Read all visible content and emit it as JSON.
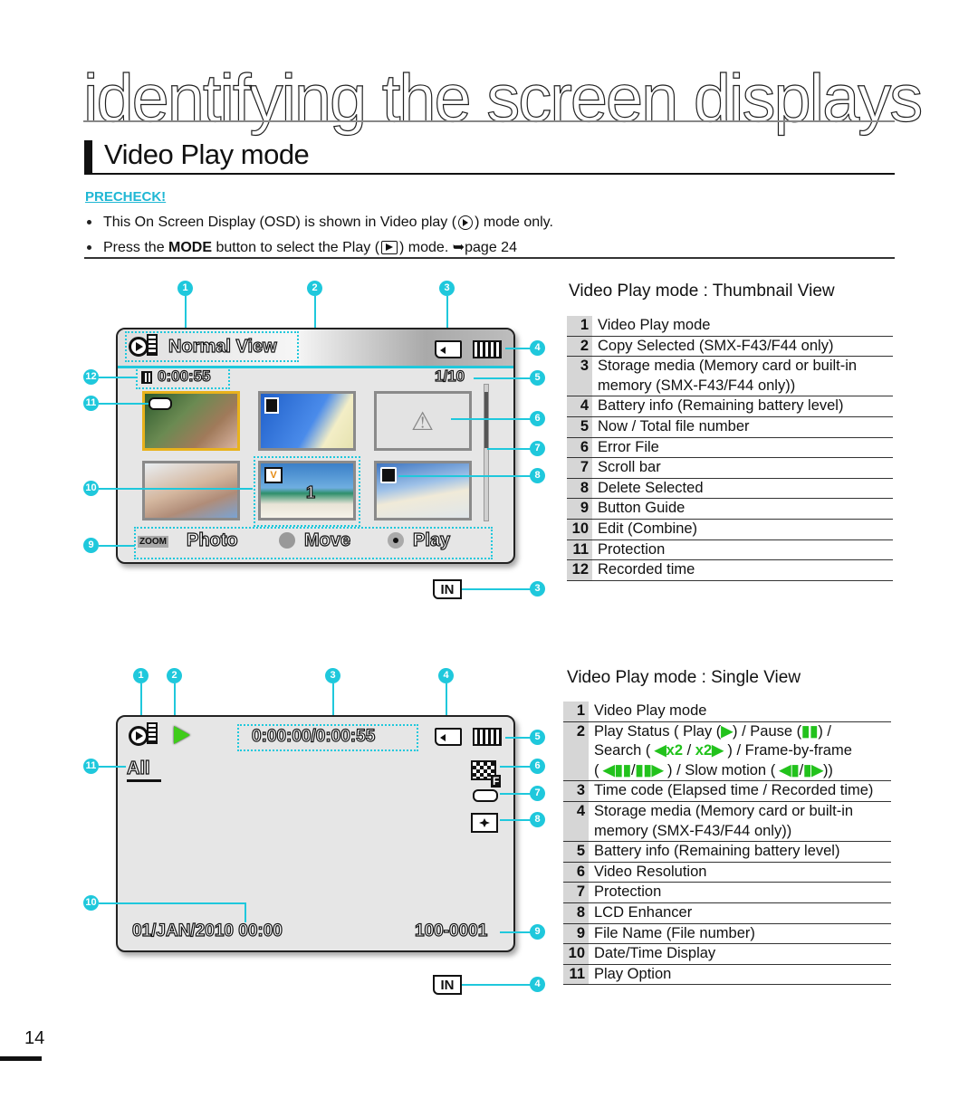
{
  "header": {
    "chapter_title": "identifying the screen displays",
    "section_title": "Video Play mode"
  },
  "precheck": {
    "label": "PRECHECK!",
    "bullets": [
      {
        "before": "This On Screen Display (OSD) is shown in Video play (",
        "icon": "video-play-mode-icon",
        "after": ") mode only."
      },
      {
        "before": "Press the ",
        "bold": "MODE",
        "middle": " button to select the Play (",
        "icon": "play-mode-icon",
        "after": ") mode. ",
        "ref_arrow": "➥",
        "ref": "page 24"
      }
    ]
  },
  "thumbnail_view": {
    "osd": {
      "mode_label": "Normal View",
      "recorded_time": "0:00:55",
      "file_counter": "1/10",
      "combine_number": "1",
      "button_guide": {
        "zoom_key": "ZOOM",
        "zoom_action": "Photo",
        "move_action": "Move",
        "play_action": "Play"
      },
      "storage_label": "IN"
    },
    "callouts": [
      "1",
      "2",
      "3",
      "4",
      "5",
      "6",
      "7",
      "8",
      "9",
      "10",
      "11",
      "12",
      "3"
    ],
    "legend_title": "Video Play mode : Thumbnail View",
    "legend": [
      {
        "num": "1",
        "text": "Video Play mode"
      },
      {
        "num": "2",
        "text": "Copy Selected (SMX-F43/F44 only)"
      },
      {
        "num": "3",
        "text": "Storage media (Memory card or built-in memory (SMX-F43/F44 only))"
      },
      {
        "num": "4",
        "text": "Battery info (Remaining battery level)"
      },
      {
        "num": "5",
        "text": "Now / Total file number"
      },
      {
        "num": "6",
        "text": "Error File"
      },
      {
        "num": "7",
        "text": "Scroll bar"
      },
      {
        "num": "8",
        "text": "Delete Selected"
      },
      {
        "num": "9",
        "text": "Button Guide"
      },
      {
        "num": "10",
        "text": "Edit (Combine)"
      },
      {
        "num": "11",
        "text": "Protection"
      },
      {
        "num": "12",
        "text": "Recorded time"
      }
    ]
  },
  "single_view": {
    "osd": {
      "time_code": "0:00:00/0:00:55",
      "play_option": "All",
      "date_time": "01/JAN/2010 00:00",
      "file_name": "100-0001",
      "storage_label": "IN"
    },
    "callouts": [
      "1",
      "2",
      "3",
      "4",
      "5",
      "6",
      "7",
      "8",
      "9",
      "10",
      "11",
      "4"
    ],
    "legend_title": "Video Play mode : Single View",
    "legend": [
      {
        "num": "1",
        "text": "Video Play mode"
      },
      {
        "num": "2",
        "parts": [
          "Play Status ( Play (",
          ") / Pause (",
          ") /",
          "Search ( ",
          " / ",
          " ) / Frame-by-frame",
          "( ",
          "/",
          " ) / Slow motion ( ",
          "/",
          "))"
        ]
      },
      {
        "num": "3",
        "text": "Time code (Elapsed time / Recorded time)"
      },
      {
        "num": "4",
        "text": "Storage media (Memory card or built-in memory (SMX-F43/F44 only))"
      },
      {
        "num": "5",
        "text": "Battery info (Remaining battery level)"
      },
      {
        "num": "6",
        "text": "Video Resolution"
      },
      {
        "num": "7",
        "text": "Protection"
      },
      {
        "num": "8",
        "text": "LCD Enhancer"
      },
      {
        "num": "9",
        "text": "File Name (File number)"
      },
      {
        "num": "10",
        "text": "Date/Time Display"
      },
      {
        "num": "11",
        "text": "Play Option"
      }
    ],
    "search_glyphs": {
      "rew": "x2",
      "ff": "x2"
    }
  },
  "page_number": "14",
  "colors": {
    "accent": "#1fc8dc",
    "precheck": "#1fb7d4",
    "play_green": "#22c21c"
  }
}
